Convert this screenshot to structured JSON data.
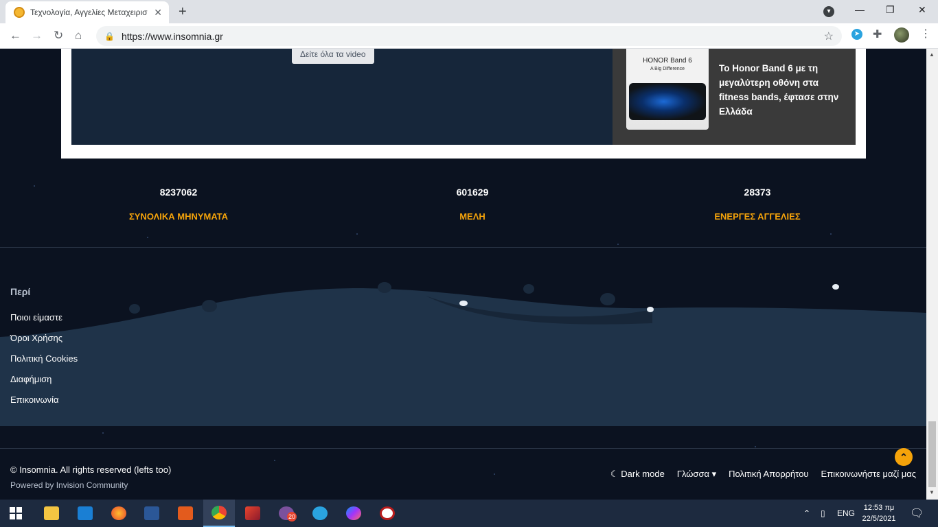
{
  "browser": {
    "tab_title": "Τεχνολογία, Αγγελίες Μεταχειρισ",
    "tab_close": "✕",
    "new_tab": "+",
    "url": "https://www.insomnia.gr",
    "minimize": "—",
    "maximize": "❐",
    "close": "✕"
  },
  "video": {
    "button_label": "Δείτε όλα τα video"
  },
  "article": {
    "thumb_brand": "HONOR Band 6",
    "thumb_tag": "A Big Difference",
    "headline": "Το Honor Band 6 με τη μεγαλύτερη οθόνη στα fitness bands, έφτασε στην Ελλάδα"
  },
  "stats": [
    {
      "value": "8237062",
      "label": "ΣΥΝΟΛΙΚΑ ΜΗΝΥΜΑΤΑ"
    },
    {
      "value": "601629",
      "label": "ΜΕΛΗ"
    },
    {
      "value": "28373",
      "label": "ΕΝΕΡΓΕΣ ΑΓΓΕΛΙΕΣ"
    }
  ],
  "footer": {
    "heading": "Περί",
    "links": [
      "Ποιοι είμαστε",
      "Όροι Χρήσης",
      "Πολιτική Cookies",
      "Διαφήμιση",
      "Επικοινωνία"
    ],
    "copyright": "© Insomnia. All rights reserved (lefts too)",
    "powered": "Powered by Invision Community",
    "dark_mode": "Dark mode",
    "language": "Γλώσσα",
    "privacy": "Πολιτική Απορρήτου",
    "contact": "Επικοινωνήστε μαζί μας"
  },
  "taskbar": {
    "language": "ENG",
    "time": "12:53 πμ",
    "date": "22/5/2021",
    "viber_badge": "20"
  },
  "colors": {
    "accent_orange": "#f5a30a",
    "page_bg": "#0b1220",
    "hill": "#1f3349"
  }
}
